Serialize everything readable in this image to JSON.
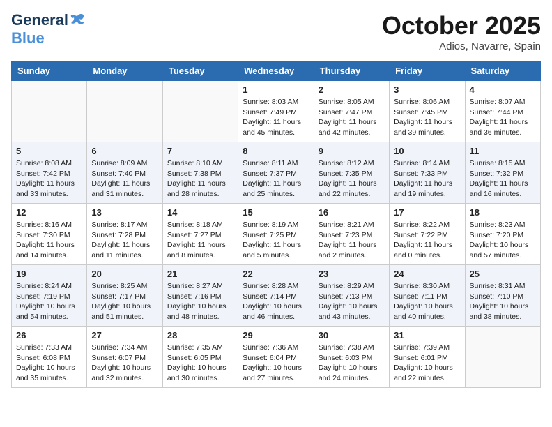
{
  "logo": {
    "general": "General",
    "blue": "Blue"
  },
  "title": "October 2025",
  "location": "Adios, Navarre, Spain",
  "days_of_week": [
    "Sunday",
    "Monday",
    "Tuesday",
    "Wednesday",
    "Thursday",
    "Friday",
    "Saturday"
  ],
  "weeks": [
    [
      {
        "day": "",
        "info": ""
      },
      {
        "day": "",
        "info": ""
      },
      {
        "day": "",
        "info": ""
      },
      {
        "day": "1",
        "info": "Sunrise: 8:03 AM\nSunset: 7:49 PM\nDaylight: 11 hours\nand 45 minutes."
      },
      {
        "day": "2",
        "info": "Sunrise: 8:05 AM\nSunset: 7:47 PM\nDaylight: 11 hours\nand 42 minutes."
      },
      {
        "day": "3",
        "info": "Sunrise: 8:06 AM\nSunset: 7:45 PM\nDaylight: 11 hours\nand 39 minutes."
      },
      {
        "day": "4",
        "info": "Sunrise: 8:07 AM\nSunset: 7:44 PM\nDaylight: 11 hours\nand 36 minutes."
      }
    ],
    [
      {
        "day": "5",
        "info": "Sunrise: 8:08 AM\nSunset: 7:42 PM\nDaylight: 11 hours\nand 33 minutes."
      },
      {
        "day": "6",
        "info": "Sunrise: 8:09 AM\nSunset: 7:40 PM\nDaylight: 11 hours\nand 31 minutes."
      },
      {
        "day": "7",
        "info": "Sunrise: 8:10 AM\nSunset: 7:38 PM\nDaylight: 11 hours\nand 28 minutes."
      },
      {
        "day": "8",
        "info": "Sunrise: 8:11 AM\nSunset: 7:37 PM\nDaylight: 11 hours\nand 25 minutes."
      },
      {
        "day": "9",
        "info": "Sunrise: 8:12 AM\nSunset: 7:35 PM\nDaylight: 11 hours\nand 22 minutes."
      },
      {
        "day": "10",
        "info": "Sunrise: 8:14 AM\nSunset: 7:33 PM\nDaylight: 11 hours\nand 19 minutes."
      },
      {
        "day": "11",
        "info": "Sunrise: 8:15 AM\nSunset: 7:32 PM\nDaylight: 11 hours\nand 16 minutes."
      }
    ],
    [
      {
        "day": "12",
        "info": "Sunrise: 8:16 AM\nSunset: 7:30 PM\nDaylight: 11 hours\nand 14 minutes."
      },
      {
        "day": "13",
        "info": "Sunrise: 8:17 AM\nSunset: 7:28 PM\nDaylight: 11 hours\nand 11 minutes."
      },
      {
        "day": "14",
        "info": "Sunrise: 8:18 AM\nSunset: 7:27 PM\nDaylight: 11 hours\nand 8 minutes."
      },
      {
        "day": "15",
        "info": "Sunrise: 8:19 AM\nSunset: 7:25 PM\nDaylight: 11 hours\nand 5 minutes."
      },
      {
        "day": "16",
        "info": "Sunrise: 8:21 AM\nSunset: 7:23 PM\nDaylight: 11 hours\nand 2 minutes."
      },
      {
        "day": "17",
        "info": "Sunrise: 8:22 AM\nSunset: 7:22 PM\nDaylight: 11 hours\nand 0 minutes."
      },
      {
        "day": "18",
        "info": "Sunrise: 8:23 AM\nSunset: 7:20 PM\nDaylight: 10 hours\nand 57 minutes."
      }
    ],
    [
      {
        "day": "19",
        "info": "Sunrise: 8:24 AM\nSunset: 7:19 PM\nDaylight: 10 hours\nand 54 minutes."
      },
      {
        "day": "20",
        "info": "Sunrise: 8:25 AM\nSunset: 7:17 PM\nDaylight: 10 hours\nand 51 minutes."
      },
      {
        "day": "21",
        "info": "Sunrise: 8:27 AM\nSunset: 7:16 PM\nDaylight: 10 hours\nand 48 minutes."
      },
      {
        "day": "22",
        "info": "Sunrise: 8:28 AM\nSunset: 7:14 PM\nDaylight: 10 hours\nand 46 minutes."
      },
      {
        "day": "23",
        "info": "Sunrise: 8:29 AM\nSunset: 7:13 PM\nDaylight: 10 hours\nand 43 minutes."
      },
      {
        "day": "24",
        "info": "Sunrise: 8:30 AM\nSunset: 7:11 PM\nDaylight: 10 hours\nand 40 minutes."
      },
      {
        "day": "25",
        "info": "Sunrise: 8:31 AM\nSunset: 7:10 PM\nDaylight: 10 hours\nand 38 minutes."
      }
    ],
    [
      {
        "day": "26",
        "info": "Sunrise: 7:33 AM\nSunset: 6:08 PM\nDaylight: 10 hours\nand 35 minutes."
      },
      {
        "day": "27",
        "info": "Sunrise: 7:34 AM\nSunset: 6:07 PM\nDaylight: 10 hours\nand 32 minutes."
      },
      {
        "day": "28",
        "info": "Sunrise: 7:35 AM\nSunset: 6:05 PM\nDaylight: 10 hours\nand 30 minutes."
      },
      {
        "day": "29",
        "info": "Sunrise: 7:36 AM\nSunset: 6:04 PM\nDaylight: 10 hours\nand 27 minutes."
      },
      {
        "day": "30",
        "info": "Sunrise: 7:38 AM\nSunset: 6:03 PM\nDaylight: 10 hours\nand 24 minutes."
      },
      {
        "day": "31",
        "info": "Sunrise: 7:39 AM\nSunset: 6:01 PM\nDaylight: 10 hours\nand 22 minutes."
      },
      {
        "day": "",
        "info": ""
      }
    ]
  ]
}
